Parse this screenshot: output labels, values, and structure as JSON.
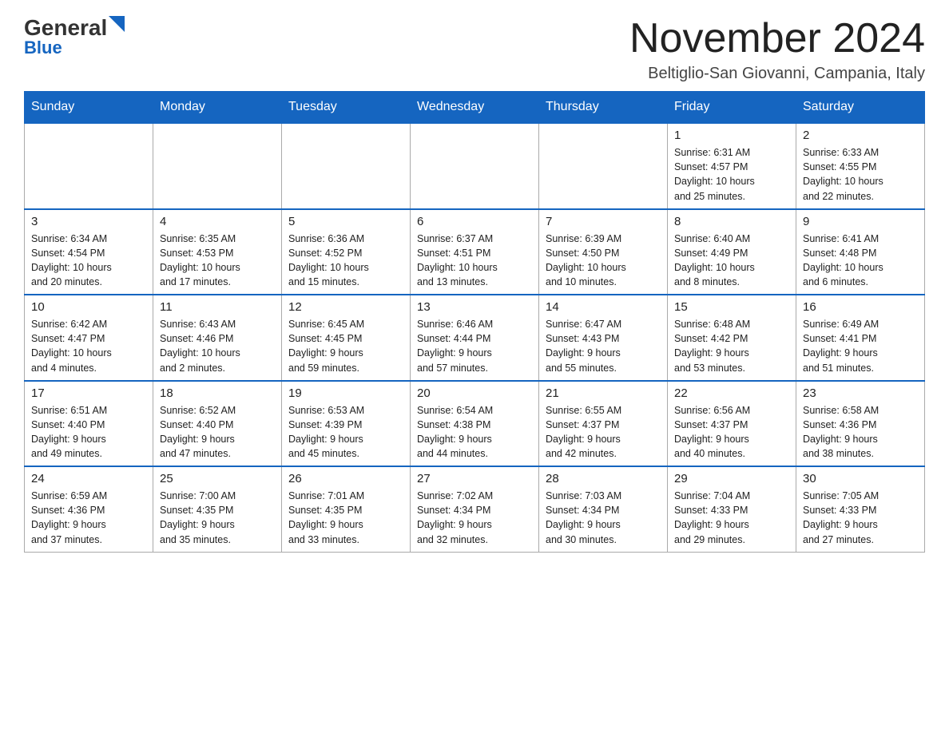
{
  "header": {
    "logo_general": "General",
    "logo_blue": "Blue",
    "month_title": "November 2024",
    "location": "Beltiglio-San Giovanni, Campania, Italy"
  },
  "days_of_week": [
    "Sunday",
    "Monday",
    "Tuesday",
    "Wednesday",
    "Thursday",
    "Friday",
    "Saturday"
  ],
  "weeks": [
    [
      {
        "day": "",
        "info": ""
      },
      {
        "day": "",
        "info": ""
      },
      {
        "day": "",
        "info": ""
      },
      {
        "day": "",
        "info": ""
      },
      {
        "day": "",
        "info": ""
      },
      {
        "day": "1",
        "info": "Sunrise: 6:31 AM\nSunset: 4:57 PM\nDaylight: 10 hours\nand 25 minutes."
      },
      {
        "day": "2",
        "info": "Sunrise: 6:33 AM\nSunset: 4:55 PM\nDaylight: 10 hours\nand 22 minutes."
      }
    ],
    [
      {
        "day": "3",
        "info": "Sunrise: 6:34 AM\nSunset: 4:54 PM\nDaylight: 10 hours\nand 20 minutes."
      },
      {
        "day": "4",
        "info": "Sunrise: 6:35 AM\nSunset: 4:53 PM\nDaylight: 10 hours\nand 17 minutes."
      },
      {
        "day": "5",
        "info": "Sunrise: 6:36 AM\nSunset: 4:52 PM\nDaylight: 10 hours\nand 15 minutes."
      },
      {
        "day": "6",
        "info": "Sunrise: 6:37 AM\nSunset: 4:51 PM\nDaylight: 10 hours\nand 13 minutes."
      },
      {
        "day": "7",
        "info": "Sunrise: 6:39 AM\nSunset: 4:50 PM\nDaylight: 10 hours\nand 10 minutes."
      },
      {
        "day": "8",
        "info": "Sunrise: 6:40 AM\nSunset: 4:49 PM\nDaylight: 10 hours\nand 8 minutes."
      },
      {
        "day": "9",
        "info": "Sunrise: 6:41 AM\nSunset: 4:48 PM\nDaylight: 10 hours\nand 6 minutes."
      }
    ],
    [
      {
        "day": "10",
        "info": "Sunrise: 6:42 AM\nSunset: 4:47 PM\nDaylight: 10 hours\nand 4 minutes."
      },
      {
        "day": "11",
        "info": "Sunrise: 6:43 AM\nSunset: 4:46 PM\nDaylight: 10 hours\nand 2 minutes."
      },
      {
        "day": "12",
        "info": "Sunrise: 6:45 AM\nSunset: 4:45 PM\nDaylight: 9 hours\nand 59 minutes."
      },
      {
        "day": "13",
        "info": "Sunrise: 6:46 AM\nSunset: 4:44 PM\nDaylight: 9 hours\nand 57 minutes."
      },
      {
        "day": "14",
        "info": "Sunrise: 6:47 AM\nSunset: 4:43 PM\nDaylight: 9 hours\nand 55 minutes."
      },
      {
        "day": "15",
        "info": "Sunrise: 6:48 AM\nSunset: 4:42 PM\nDaylight: 9 hours\nand 53 minutes."
      },
      {
        "day": "16",
        "info": "Sunrise: 6:49 AM\nSunset: 4:41 PM\nDaylight: 9 hours\nand 51 minutes."
      }
    ],
    [
      {
        "day": "17",
        "info": "Sunrise: 6:51 AM\nSunset: 4:40 PM\nDaylight: 9 hours\nand 49 minutes."
      },
      {
        "day": "18",
        "info": "Sunrise: 6:52 AM\nSunset: 4:40 PM\nDaylight: 9 hours\nand 47 minutes."
      },
      {
        "day": "19",
        "info": "Sunrise: 6:53 AM\nSunset: 4:39 PM\nDaylight: 9 hours\nand 45 minutes."
      },
      {
        "day": "20",
        "info": "Sunrise: 6:54 AM\nSunset: 4:38 PM\nDaylight: 9 hours\nand 44 minutes."
      },
      {
        "day": "21",
        "info": "Sunrise: 6:55 AM\nSunset: 4:37 PM\nDaylight: 9 hours\nand 42 minutes."
      },
      {
        "day": "22",
        "info": "Sunrise: 6:56 AM\nSunset: 4:37 PM\nDaylight: 9 hours\nand 40 minutes."
      },
      {
        "day": "23",
        "info": "Sunrise: 6:58 AM\nSunset: 4:36 PM\nDaylight: 9 hours\nand 38 minutes."
      }
    ],
    [
      {
        "day": "24",
        "info": "Sunrise: 6:59 AM\nSunset: 4:36 PM\nDaylight: 9 hours\nand 37 minutes."
      },
      {
        "day": "25",
        "info": "Sunrise: 7:00 AM\nSunset: 4:35 PM\nDaylight: 9 hours\nand 35 minutes."
      },
      {
        "day": "26",
        "info": "Sunrise: 7:01 AM\nSunset: 4:35 PM\nDaylight: 9 hours\nand 33 minutes."
      },
      {
        "day": "27",
        "info": "Sunrise: 7:02 AM\nSunset: 4:34 PM\nDaylight: 9 hours\nand 32 minutes."
      },
      {
        "day": "28",
        "info": "Sunrise: 7:03 AM\nSunset: 4:34 PM\nDaylight: 9 hours\nand 30 minutes."
      },
      {
        "day": "29",
        "info": "Sunrise: 7:04 AM\nSunset: 4:33 PM\nDaylight: 9 hours\nand 29 minutes."
      },
      {
        "day": "30",
        "info": "Sunrise: 7:05 AM\nSunset: 4:33 PM\nDaylight: 9 hours\nand 27 minutes."
      }
    ]
  ]
}
